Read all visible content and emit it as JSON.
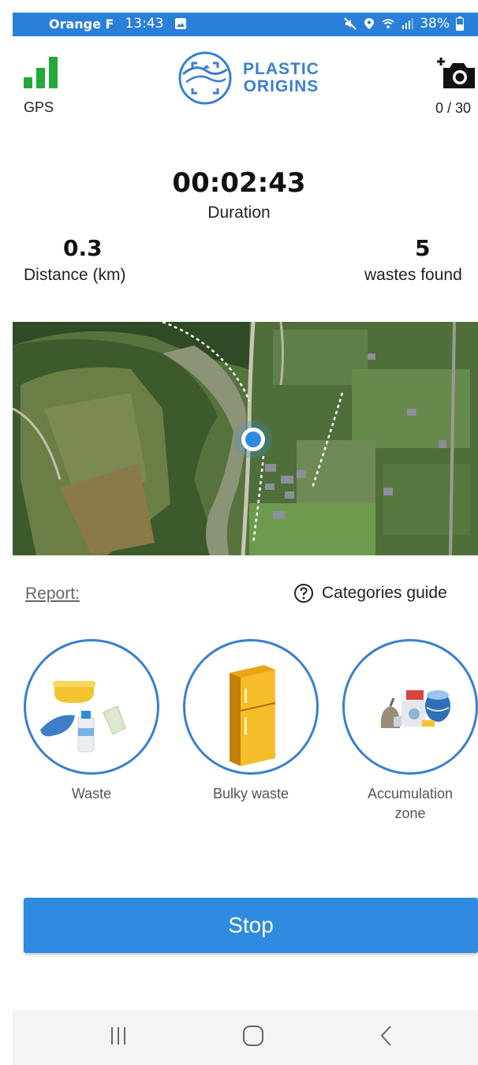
{
  "status_bar": {
    "carrier": "Orange F",
    "time": "13:43",
    "battery": "38%"
  },
  "header": {
    "gps_label": "GPS",
    "logo_line1": "PLASTIC",
    "logo_line2": "ORIGINS",
    "photo_count": "0 / 30"
  },
  "stats": {
    "duration_value": "00:02:43",
    "duration_label": "Duration",
    "distance_value": "0.3",
    "distance_label": "Distance (km)",
    "wastes_value": "5",
    "wastes_label": "wastes found"
  },
  "report": {
    "label": "Report:",
    "guide_label": "Categories guide",
    "categories": [
      {
        "label": "Waste"
      },
      {
        "label": "Bulky waste"
      },
      {
        "label_line1": "Accumulation",
        "label_line2": "zone"
      }
    ]
  },
  "actions": {
    "stop_label": "Stop"
  },
  "colors": {
    "accent": "#2f8be0",
    "gps_signal": "#25a83a",
    "status_bar": "#2a7fd8"
  },
  "icons": [
    "gps-signal-icon",
    "add-photo-icon",
    "help-circle-icon",
    "location-dot-icon",
    "recent-apps-icon",
    "home-icon",
    "back-icon"
  ]
}
